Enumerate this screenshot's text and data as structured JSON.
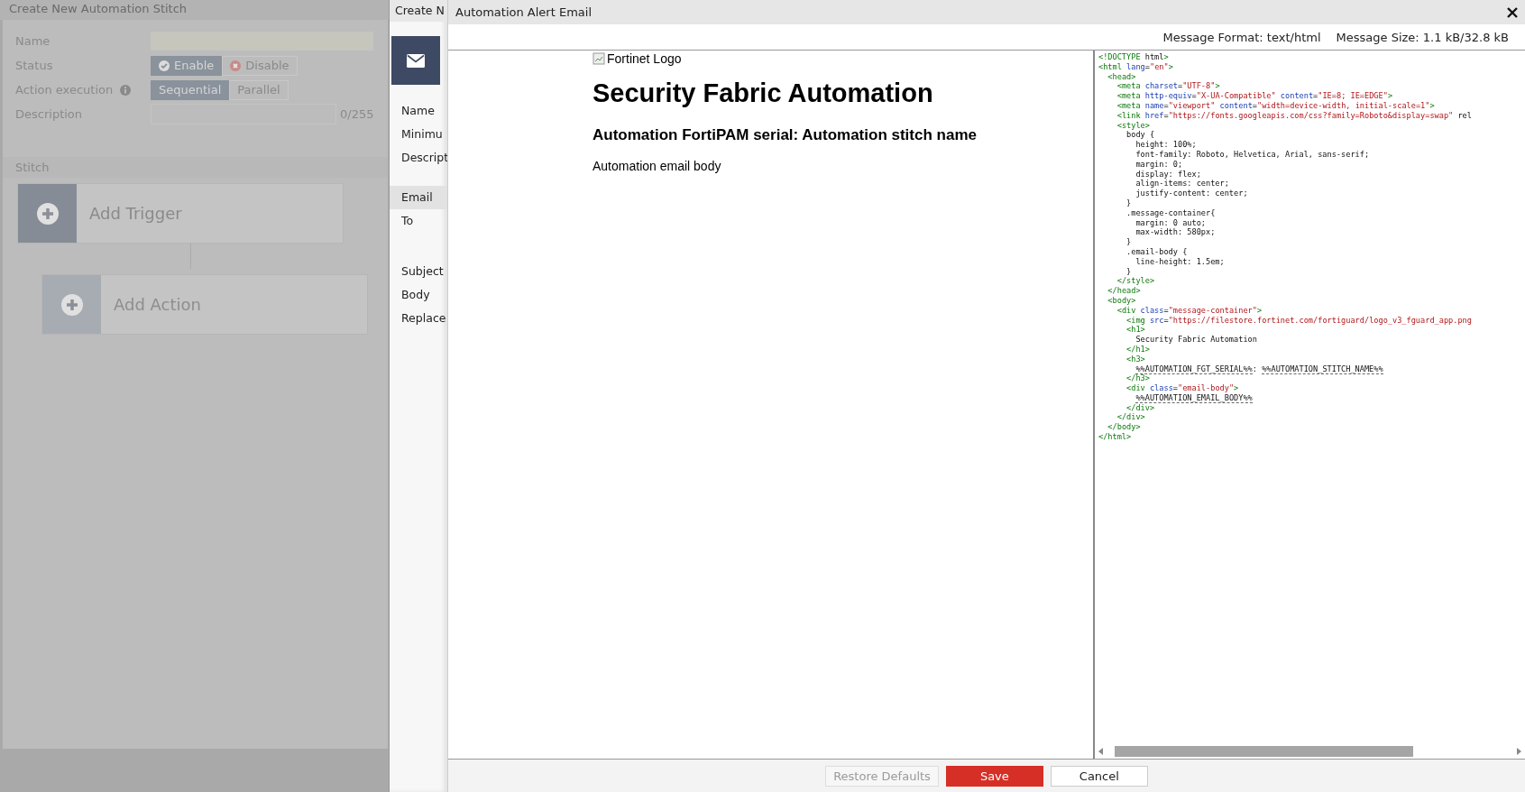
{
  "background_page": {
    "title": "Create New Automation Stitch",
    "fields": [
      {
        "kind": "text",
        "label": "Name"
      },
      {
        "kind": "status",
        "label": "Status",
        "options": [
          {
            "label": "Enable",
            "selected": true
          },
          {
            "label": "Disable",
            "selected": false
          }
        ]
      },
      {
        "kind": "segmented",
        "label": "Action execution",
        "info": true,
        "options": [
          {
            "label": "Sequential",
            "selected": true
          },
          {
            "label": "Parallel",
            "selected": false
          }
        ]
      },
      {
        "kind": "textarea",
        "label": "Description",
        "counter": "0/255"
      }
    ],
    "section": "Stitch",
    "trigger": "Add Trigger",
    "action": "Add Action"
  },
  "action_panel": {
    "title": "Create N",
    "labels": [
      {
        "text": "Name",
        "highlighted": false
      },
      {
        "text": "Minimu",
        "highlighted": false
      },
      {
        "text": "Descript",
        "highlighted": false
      },
      {
        "text": "Email",
        "highlighted": true
      },
      {
        "text": "To",
        "highlighted": false
      },
      {
        "text": "Subject",
        "highlighted": false
      },
      {
        "text": "Body",
        "highlighted": false
      },
      {
        "text": "Replace",
        "highlighted": false
      }
    ]
  },
  "dialog": {
    "title": "Automation Alert Email",
    "message_format": "Message Format: text/html",
    "message_size": "Message Size: 1.1 kB/32.8 kB",
    "preview": {
      "image_alt": "Fortinet Logo",
      "heading": "Security Fabric Automation",
      "subheading": "Automation FortiPAM serial: Automation stitch name",
      "body": "Automation email body"
    },
    "code_lines": [
      "<!DOCTYPE html>",
      "<html lang=\"en\">",
      "  <head>",
      "    <meta charset=\"UTF-8\">",
      "    <meta http-equiv=\"X-UA-Compatible\" content=\"IE=8; IE=EDGE\">",
      "    <meta name=\"viewport\" content=\"width=device-width, initial-scale=1\">",
      "    <link href=\"https://fonts.googleapis.com/css?family=Roboto&display=swap\" rel",
      "    <style>",
      "      body {",
      "        height: 100%;",
      "        font-family: Roboto, Helvetica, Arial, sans-serif;",
      "        margin: 0;",
      "        display: flex;",
      "        align-items: center;",
      "        justify-content: center;",
      "      }",
      "      .message-container{",
      "        margin: 0 auto;",
      "        max-width: 580px;",
      "      }",
      "      .email-body {",
      "        line-height: 1.5em;",
      "      }",
      "    </style>",
      "  </head>",
      "  <body>",
      "    <div class=\"message-container\">",
      "      <img src=\"https://filestore.fortinet.com/fortiguard/logo_v3_fguard_app.png",
      "      <h1>",
      "        Security Fabric Automation",
      "      </h1>",
      "      <h3>",
      "        %%AUTOMATION_FGT_SERIAL%%: %%AUTOMATION_STITCH_NAME%%",
      "      </h3>",
      "      <div class=\"email-body\">",
      "        %%AUTOMATION_EMAIL_BODY%%",
      "      </div>",
      "    </div>",
      "  </body>",
      "</html>"
    ],
    "buttons": [
      {
        "kind": "default",
        "label": "Restore Defaults",
        "disabled": true
      },
      {
        "kind": "primary",
        "label": "Save",
        "disabled": false
      },
      {
        "kind": "default",
        "label": "Cancel",
        "disabled": false
      }
    ]
  }
}
